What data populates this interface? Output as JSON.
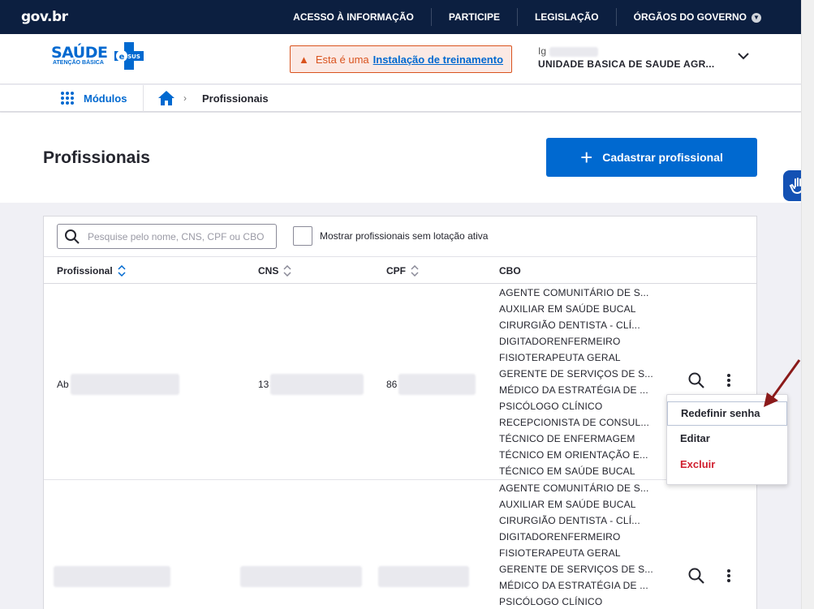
{
  "gov": {
    "logo": "gov.br",
    "links": [
      "ACESSO À INFORMAÇÃO",
      "PARTICIPE",
      "LEGISLAÇÃO",
      "ÓRGÃOS DO GOVERNO"
    ]
  },
  "header": {
    "logo_main": "SAÚDE",
    "logo_sub": "ATENÇÃO BÁSICA",
    "logo_badge": "SUS",
    "training_prefix": "Esta é uma",
    "training_link": "Instalação de treinamento",
    "user_name": "Ig",
    "unit": "UNIDADE BASICA DE SAUDE AGR..."
  },
  "breadcrumb": {
    "modules": "Módulos",
    "current": "Profissionais"
  },
  "page": {
    "title": "Profissionais",
    "add_button": "Cadastrar profissional"
  },
  "filters": {
    "search_placeholder": "Pesquise pelo nome, CNS, CPF ou CBO",
    "checkbox_label": "Mostrar profissionais sem lotação ativa"
  },
  "table": {
    "columns": [
      "Profissional",
      "CNS",
      "CPF",
      "CBO"
    ],
    "rows": [
      {
        "name": "Ab",
        "cns": "13",
        "cpf": "86",
        "cbo": [
          "AGENTE COMUNITÁRIO DE S...",
          "AUXILIAR EM SAÚDE BUCAL",
          "CIRURGIÃO DENTISTA - CLÍ...",
          "DIGITADORENFERMEIRO",
          "FISIOTERAPEUTA GERAL",
          "GERENTE DE SERVIÇOS DE S...",
          "MÉDICO DA ESTRATÉGIA DE ...",
          "PSICÓLOGO CLÍNICO",
          "RECEPCIONISTA DE CONSUL...",
          "TÉCNICO DE ENFERMAGEM",
          "TÉCNICO EM ORIENTAÇÃO E...",
          "TÉCNICO EM SAÚDE BUCAL"
        ]
      },
      {
        "name": "",
        "cns": "",
        "cpf": "",
        "cbo": [
          "AGENTE COMUNITÁRIO DE S...",
          "AUXILIAR EM SAÚDE BUCAL",
          "CIRURGIÃO DENTISTA - CLÍ...",
          "DIGITADORENFERMEIRO",
          "FISIOTERAPEUTA GERAL",
          "GERENTE DE SERVIÇOS DE S...",
          "MÉDICO DA ESTRATÉGIA DE ...",
          "PSICÓLOGO CLÍNICO"
        ]
      }
    ]
  },
  "menu": {
    "items": [
      "Redefinir senha",
      "Editar",
      "Excluir"
    ]
  },
  "colors": {
    "primary": "#0069d0",
    "gov_bar": "#0c1f40",
    "warning": "#d9531e",
    "danger": "#d01f2f",
    "annotation_arrow": "#8b1a1a"
  }
}
